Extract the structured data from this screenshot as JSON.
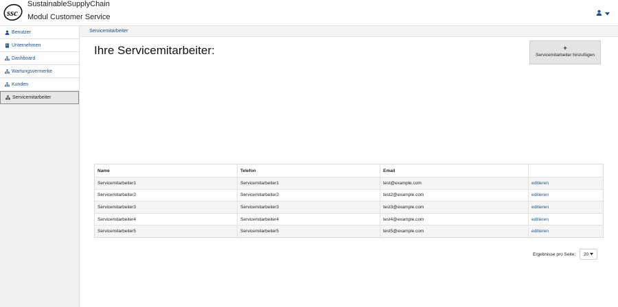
{
  "header": {
    "app_title": "SustainableSupplyChain",
    "app_subtitle": "Modul Customer Service",
    "logo_text": "ssc"
  },
  "sidebar": {
    "items": [
      {
        "label": "Benutzer",
        "icon": "user-icon"
      },
      {
        "label": "Unternehmen",
        "icon": "building-icon"
      },
      {
        "label": "Dashboard",
        "icon": "sitemap-icon"
      },
      {
        "label": "Wartungsvermerke",
        "icon": "sitemap-icon"
      },
      {
        "label": "Kunden",
        "icon": "sitemap-icon"
      },
      {
        "label": "Servicemitarbeiter",
        "icon": "sitemap-icon",
        "active": true
      }
    ]
  },
  "breadcrumb": {
    "label": "Servicemitarbeiter"
  },
  "main": {
    "title": "Ihre Servicemitarbeiter:",
    "add_button": {
      "plus": "+",
      "label": "Servicemitarbeiter hinzufügen"
    }
  },
  "table": {
    "headers": [
      "Name",
      "Telefon",
      "Email",
      ""
    ],
    "rows": [
      {
        "name": "Servicemitarbeiter1",
        "phone": "Servicemitarbeiter1",
        "email": "test@example.com",
        "action": "editieren"
      },
      {
        "name": "Servicemitarbeiter2",
        "phone": "Servicemitarbeiter2",
        "email": "test2@example.com",
        "action": "editieren"
      },
      {
        "name": "Servicemitarbeiter3",
        "phone": "Servicemitarbeiter3",
        "email": "test3@example.com",
        "action": "editieren"
      },
      {
        "name": "Servicemitarbeiter4",
        "phone": "Servicemitarbeiter4",
        "email": "test4@example.com",
        "action": "editieren"
      },
      {
        "name": "Servicemitarbeiter5",
        "phone": "Servicemitarbeiter5",
        "email": "test5@example.com",
        "action": "editieren"
      }
    ]
  },
  "pagination": {
    "label": "Ergebnisse pro Seite:",
    "selected": "20"
  },
  "colors": {
    "link": "#1f4f8a",
    "sidebar_bg": "#f0f0f0",
    "button_bg": "#e4e4e4"
  }
}
